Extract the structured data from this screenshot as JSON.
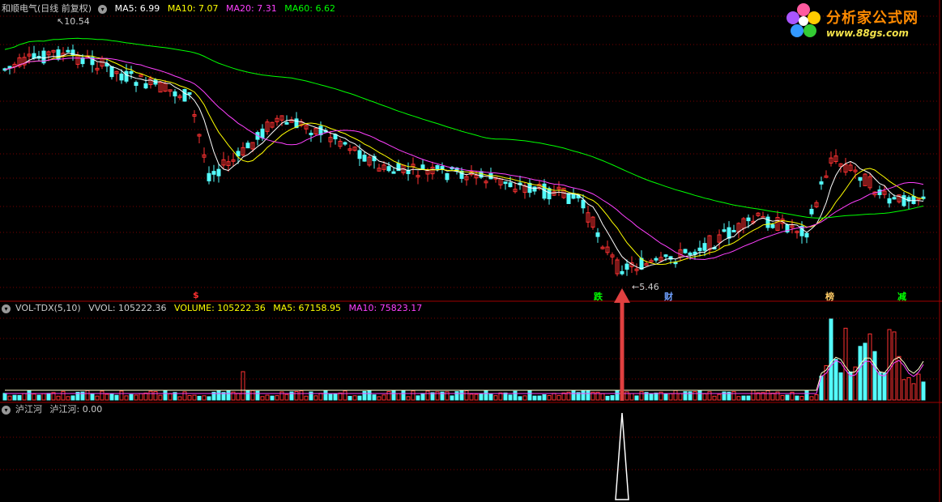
{
  "main_legend": {
    "title": "和顺电气(日线 前复权)",
    "ma5": "MA5: 6.99",
    "ma10": "MA10: 7.07",
    "ma20": "MA20: 7.31",
    "ma60": "MA60: 6.62",
    "colors": {
      "title": "#cccccc",
      "ma5": "#ffffff",
      "ma10": "#ffff00",
      "ma20": "#ff40ff",
      "ma60": "#00ff00"
    }
  },
  "vol_legend": {
    "indicator": "VOL-TDX(5,10)",
    "vvol": "VVOL: 105222.36",
    "volume": "VOLUME: 105222.36",
    "ma5": "MA5: 67158.95",
    "ma10": "MA10: 75823.17"
  },
  "sub_legend": {
    "indicator": "泸江河",
    "value": "泸江河: 0.00"
  },
  "price_labels": {
    "high": "10.54",
    "low": "5.46"
  },
  "event_markers": [
    {
      "label": "$",
      "color": "#ff3030"
    },
    {
      "label": "跌",
      "color": "#00ff00"
    },
    {
      "label": "财",
      "color": "#6fa0ff"
    },
    {
      "label": "榜",
      "color": "#ffcc66"
    },
    {
      "label": "减",
      "color": "#00ff00"
    }
  ],
  "logo": {
    "title": "分析家公式网",
    "url": "www.88gs.com"
  },
  "colors": {
    "up": "#ff3232",
    "down": "#54fcfc",
    "grid": "#7a0000",
    "divider": "#a00000",
    "arrow": "#e04040"
  }
}
